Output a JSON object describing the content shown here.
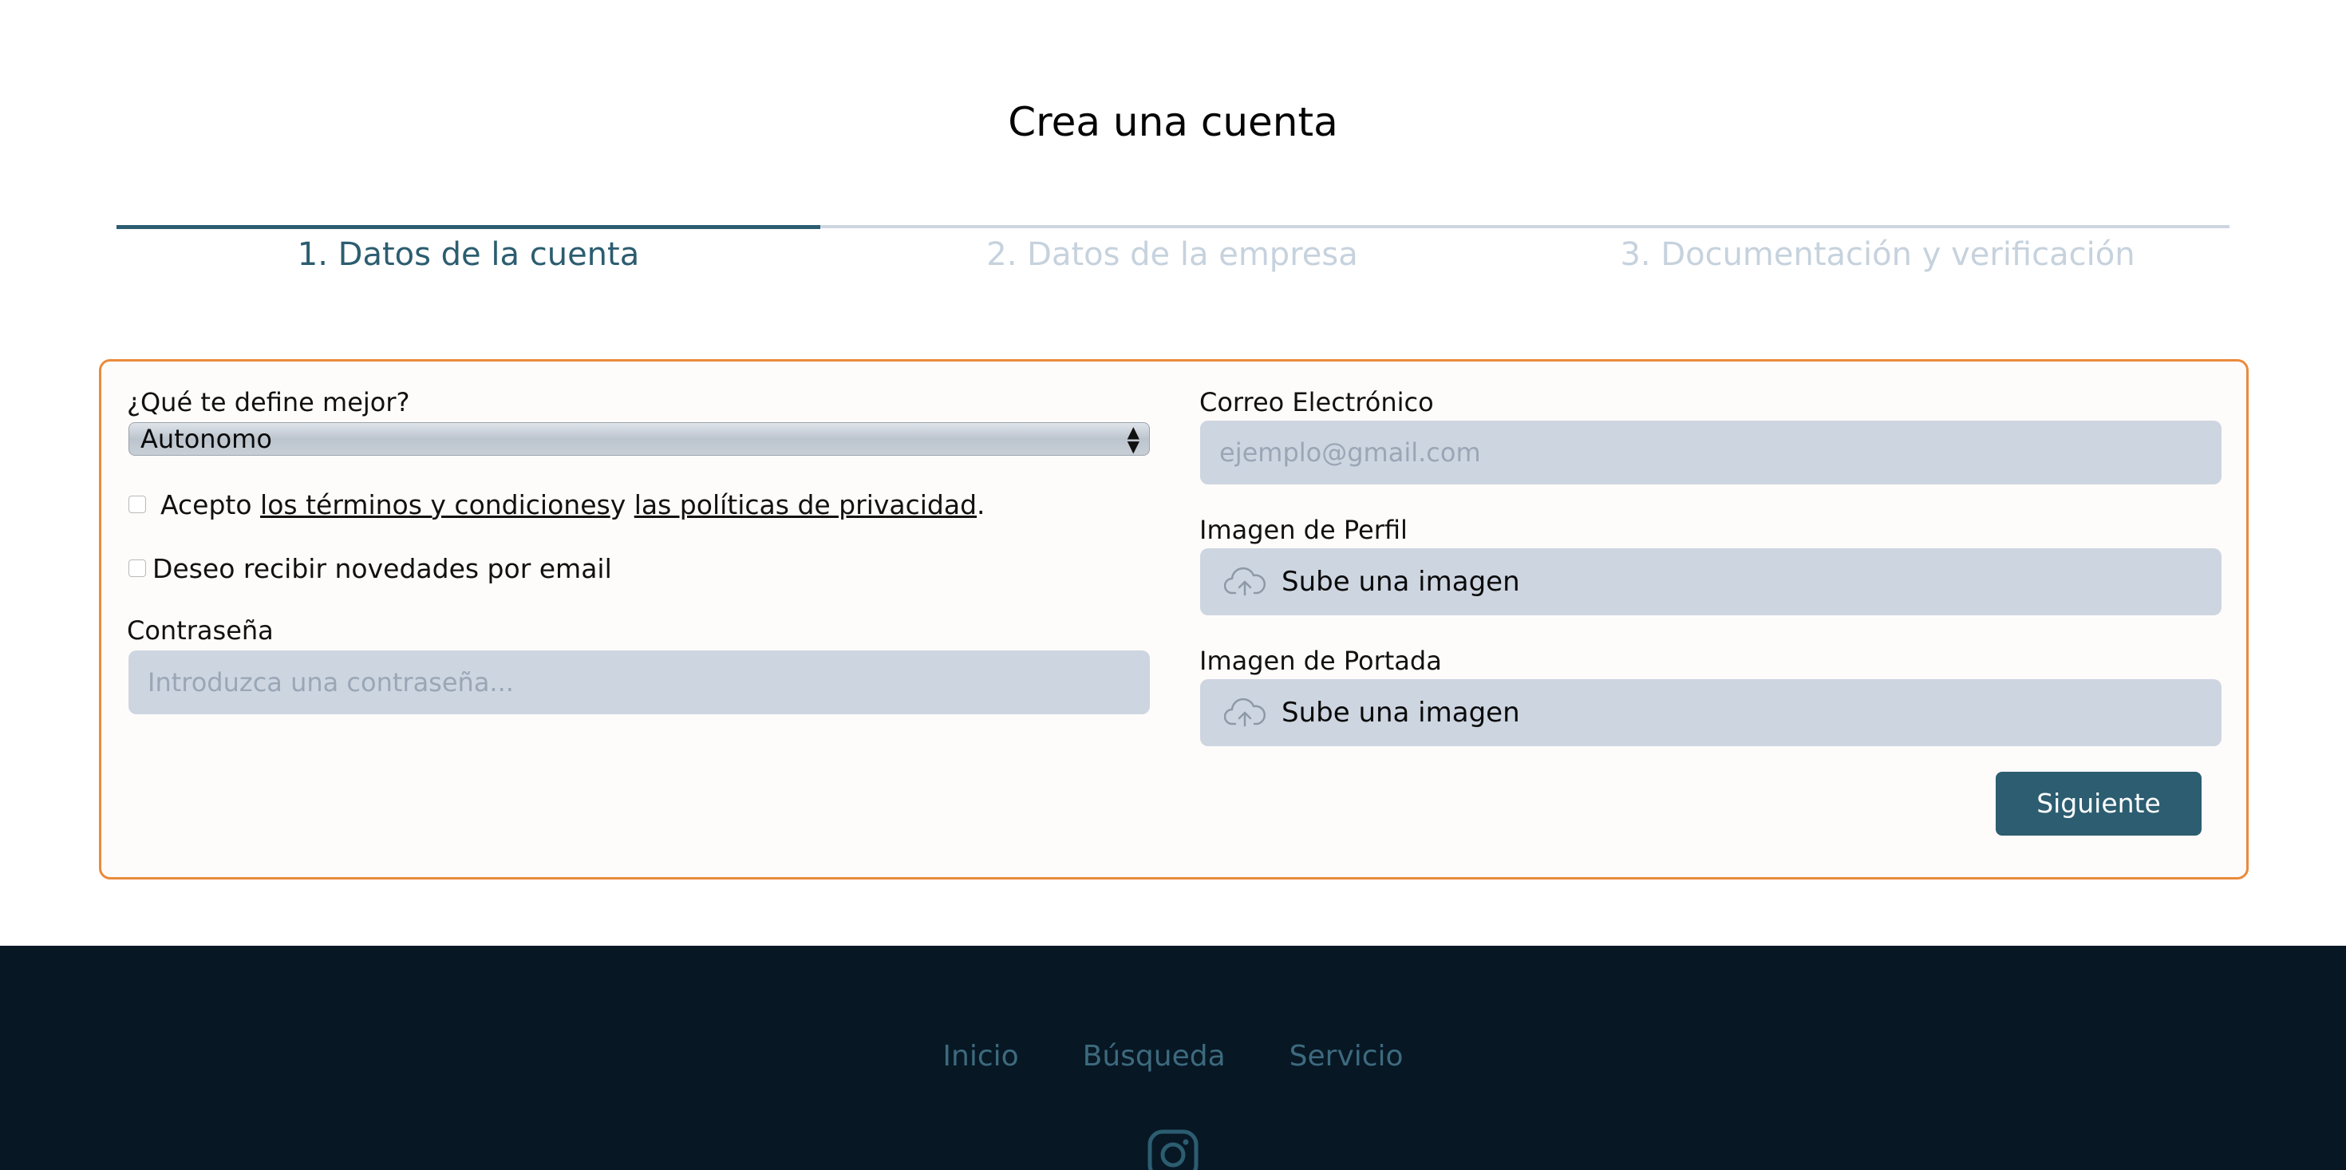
{
  "page": {
    "title": "Crea una cuenta"
  },
  "stepper": {
    "steps": [
      {
        "label": "1. Datos de la cuenta",
        "active": true
      },
      {
        "label": "2. Datos de la empresa",
        "active": false
      },
      {
        "label": "3. Documentación y verificación",
        "active": false
      }
    ]
  },
  "form": {
    "role": {
      "label": "¿Qué te define mejor?",
      "selected": "Autonomo"
    },
    "terms": {
      "prefix": "Acepto",
      "terms_link": "los términos y condiciones ",
      "conj": "y",
      "privacy_link": "las políticas de privacidad ",
      "suffix": ".",
      "checked": false
    },
    "newsletter": {
      "label": "Deseo recibir novedades por email",
      "checked": false
    },
    "password": {
      "label": "Contraseña",
      "placeholder": "Introduzca una contraseña..."
    },
    "email": {
      "label": "Correo Electrónico",
      "placeholder": "ejemplo@gmail.com"
    },
    "profile_image": {
      "label": "Imagen de Perfil",
      "button_text": "Sube una imagen"
    },
    "cover_image": {
      "label": "Imagen de Portada",
      "button_text": "Sube una imagen"
    },
    "submit_label": "Siguiente"
  },
  "footer": {
    "links": [
      "Inicio",
      "Búsqueda",
      "Servicio"
    ],
    "social_icon": "instagram-icon"
  },
  "colors": {
    "accent": "#2c5d70",
    "card_border": "#ea8a3c",
    "input_bg": "#cdd5e0",
    "footer_bg": "#071724"
  }
}
